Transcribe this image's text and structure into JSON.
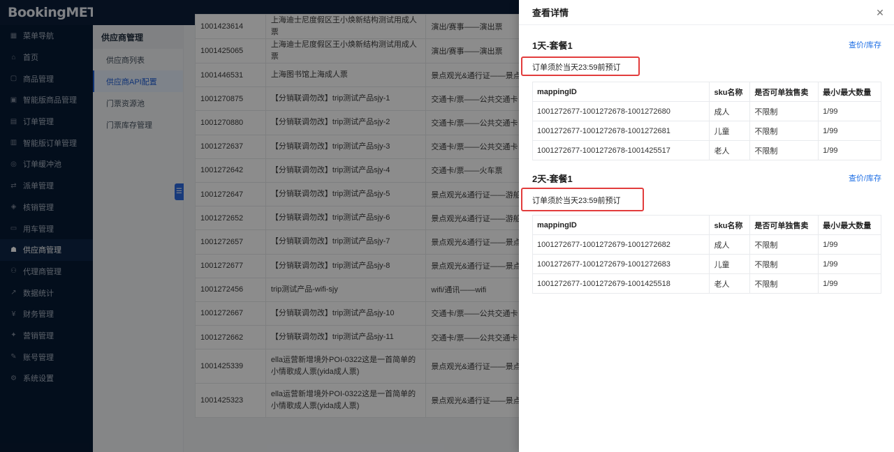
{
  "app": {
    "logo": "BookingMETA"
  },
  "sidebar": {
    "items": [
      {
        "label": "菜单导航",
        "icon": "grid-icon"
      },
      {
        "label": "首页",
        "icon": "home-icon"
      },
      {
        "label": "商品管理",
        "icon": "product-icon"
      },
      {
        "label": "智能版商品管理",
        "icon": "smart-product-icon"
      },
      {
        "label": "订单管理",
        "icon": "order-icon"
      },
      {
        "label": "智能版订单管理",
        "icon": "smart-order-icon"
      },
      {
        "label": "订单缓冲池",
        "icon": "buffer-icon"
      },
      {
        "label": "派单管理",
        "icon": "dispatch-icon"
      },
      {
        "label": "核销管理",
        "icon": "verify-icon"
      },
      {
        "label": "用车管理",
        "icon": "car-icon"
      },
      {
        "label": "供应商管理",
        "icon": "supplier-icon",
        "active": true
      },
      {
        "label": "代理商管理",
        "icon": "agent-icon"
      },
      {
        "label": "数据统计",
        "icon": "chart-icon"
      },
      {
        "label": "财务管理",
        "icon": "finance-icon"
      },
      {
        "label": "营销管理",
        "icon": "marketing-icon"
      },
      {
        "label": "账号管理",
        "icon": "account-icon"
      },
      {
        "label": "系统设置",
        "icon": "settings-icon"
      }
    ]
  },
  "submenu": {
    "title": "供应商管理",
    "items": [
      "供应商列表",
      "供应商API配置",
      "门票资源池",
      "门票库存管理"
    ],
    "active_index": 1
  },
  "table": {
    "rows": [
      {
        "id": "1001423614",
        "name": "上海迪士尼度假区王小焕新结构测试用成人票",
        "category": "演出/赛事——演出票"
      },
      {
        "id": "1001425065",
        "name": "上海迪士尼度假区王小焕新结构测试用成人票",
        "category": "演出/赛事——演出票"
      },
      {
        "id": "1001446531",
        "name": "上海图书馆上海成人票",
        "category": "景点观光&通行证——景点门"
      },
      {
        "id": "1001270875",
        "name": "【分销联调勿改】trip测试产品sjy-1",
        "category": "交通卡/票——公共交通卡"
      },
      {
        "id": "1001270880",
        "name": "【分销联调勿改】trip测试产品sjy-2",
        "category": "交通卡/票——公共交通卡"
      },
      {
        "id": "1001272637",
        "name": "【分销联调勿改】trip测试产品sjy-3",
        "category": "交通卡/票——公共交通卡"
      },
      {
        "id": "1001272642",
        "name": "【分销联调勿改】trip测试产品sjy-4",
        "category": "交通卡/票——火车票"
      },
      {
        "id": "1001272647",
        "name": "【分销联调勿改】trip测试产品sjy-5",
        "category": "景点观光&通行证——游船观"
      },
      {
        "id": "1001272652",
        "name": "【分销联调勿改】trip测试产品sjy-6",
        "category": "景点观光&通行证——游船观"
      },
      {
        "id": "1001272657",
        "name": "【分销联调勿改】trip测试产品sjy-7",
        "category": "景点观光&通行证——景点门"
      },
      {
        "id": "1001272677",
        "name": "【分销联调勿改】trip测试产品sjy-8",
        "category": "景点观光&通行证——景点门"
      },
      {
        "id": "1001272456",
        "name": "trip测试产品-wifi-sjy",
        "category": "wifi/通讯——wifi"
      },
      {
        "id": "1001272667",
        "name": "【分销联调勿改】trip测试产品sjy-10",
        "category": "交通卡/票——公共交通卡"
      },
      {
        "id": "1001272662",
        "name": "【分销联调勿改】trip测试产品sjy-11",
        "category": "交通卡/票——公共交通卡"
      },
      {
        "id": "1001425339",
        "name": "ella运营新增境外POI-0322这是一首简单的小情歌成人票(yida成人票)",
        "category": "景点观光&通行证——景点门"
      },
      {
        "id": "1001425323",
        "name": "ella运营新增境外POI-0322这是一首简单的小情歌成人票(yida成人票)",
        "category": "景点观光&通行证——景点门"
      }
    ]
  },
  "drawer": {
    "title": "查看详情",
    "headers": {
      "mapping": "mappingID",
      "sku": "sku名称",
      "single": "是否可单独售卖",
      "qty": "最小/最大数量"
    },
    "packages": [
      {
        "title": "1天-套餐1",
        "link": "查价/库存",
        "rule": "订单须於当天23:59前预订",
        "rows": [
          {
            "mapping": "1001272677-1001272678-1001272680",
            "sku": "成人",
            "single": "不限制",
            "qty": "1/99"
          },
          {
            "mapping": "1001272677-1001272678-1001272681",
            "sku": "儿童",
            "single": "不限制",
            "qty": "1/99"
          },
          {
            "mapping": "1001272677-1001272678-1001425517",
            "sku": "老人",
            "single": "不限制",
            "qty": "1/99"
          }
        ]
      },
      {
        "title": "2天-套餐1",
        "link": "查价/库存",
        "rule": "订单须於当天23:59前预订",
        "rows": [
          {
            "mapping": "1001272677-1001272679-1001272682",
            "sku": "成人",
            "single": "不限制",
            "qty": "1/99"
          },
          {
            "mapping": "1001272677-1001272679-1001272683",
            "sku": "儿童",
            "single": "不限制",
            "qty": "1/99"
          },
          {
            "mapping": "1001272677-1001272679-1001425518",
            "sku": "老人",
            "single": "不限制",
            "qty": "1/99"
          }
        ]
      }
    ]
  },
  "colors": {
    "sidebar_bg": "#071a33",
    "accent": "#1f6fe5",
    "highlight_box": "#e23c3c"
  }
}
